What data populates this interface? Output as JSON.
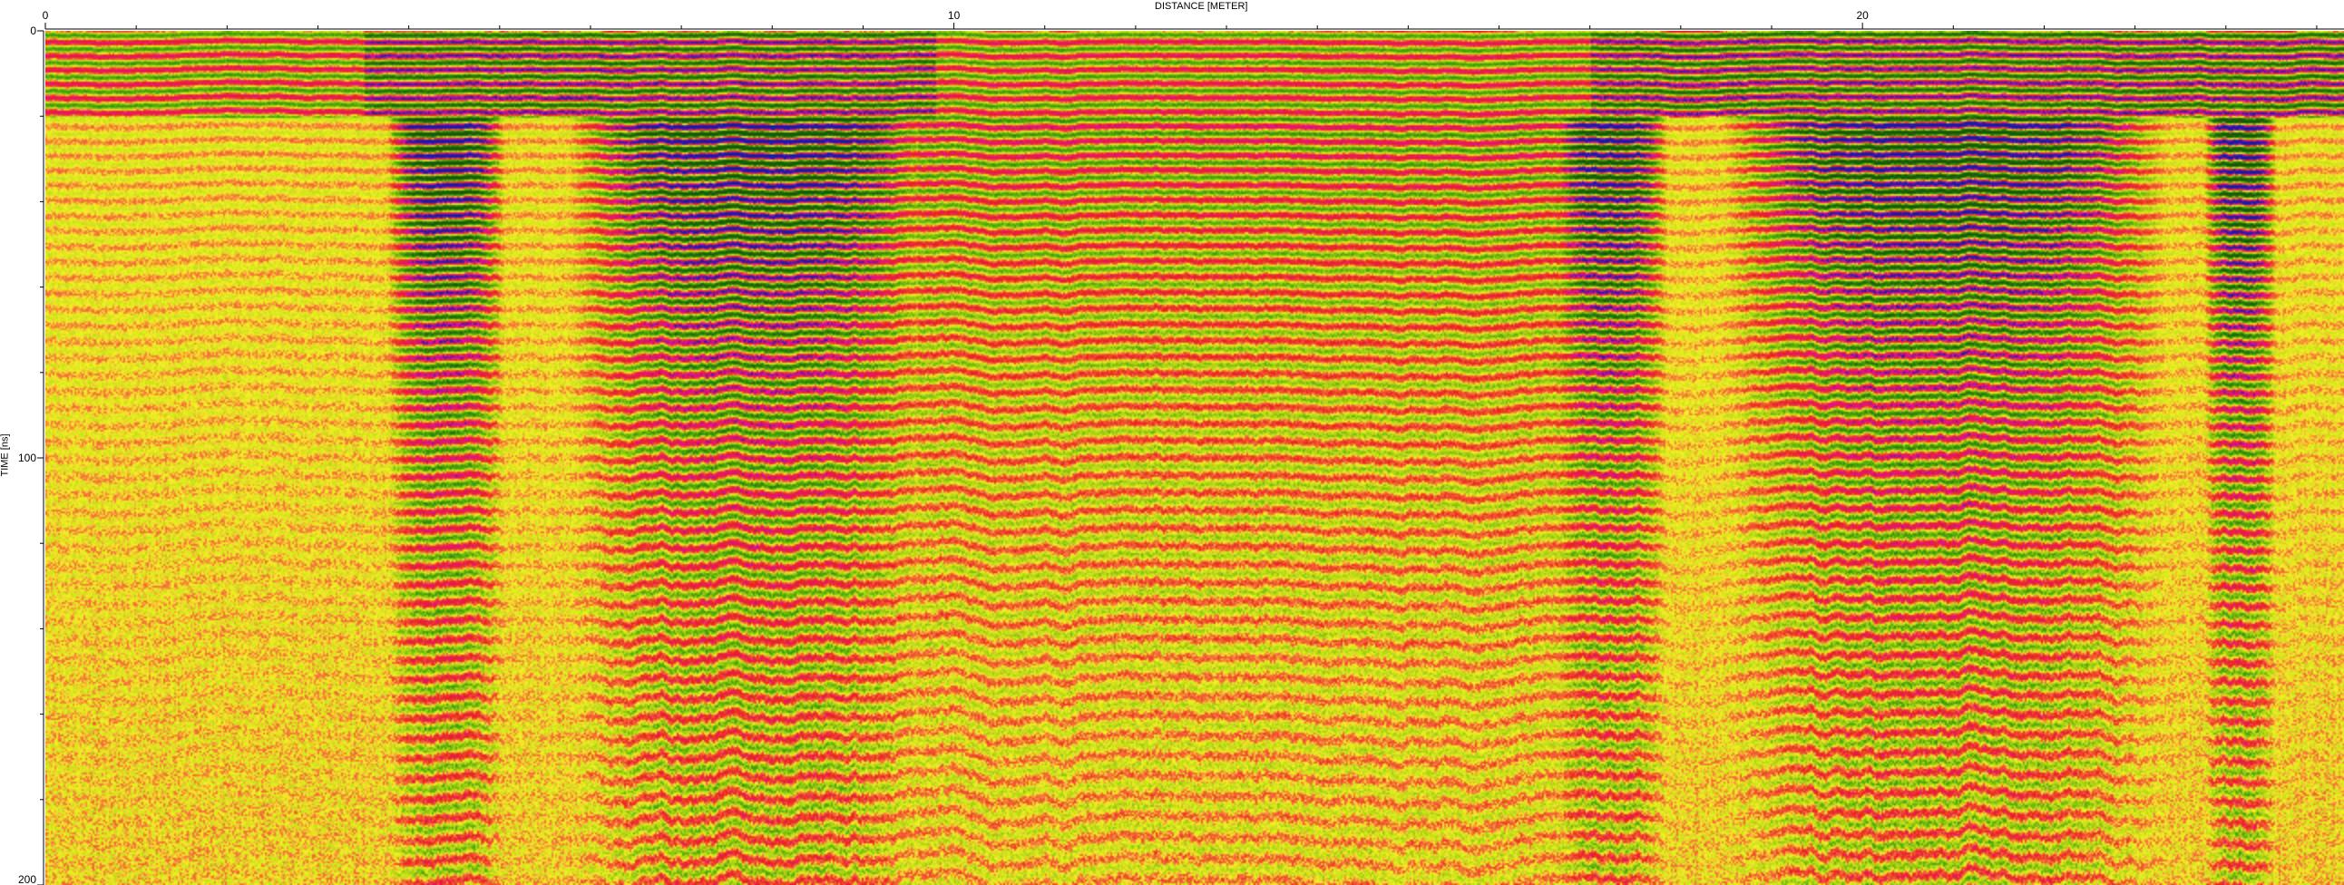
{
  "chart_data": {
    "type": "heatmap",
    "title": "",
    "xlabel": "DISTANCE [METER]",
    "ylabel": "TIME [ns]",
    "xlim": [
      0,
      25.3
    ],
    "ylim": [
      0,
      200
    ],
    "x_ticks": [
      0,
      10,
      20
    ],
    "y_ticks": [
      0,
      100,
      200
    ],
    "colormap": [
      "#1a1aa8",
      "#e6109b",
      "#e8201c",
      "#f5f226",
      "#45a80a"
    ],
    "strong_reflection_zones_m": [
      [
        4.0,
        4.8
      ],
      [
        6.0,
        9.6
      ],
      [
        16.8,
        17.6
      ],
      [
        18.7,
        23.1
      ],
      [
        24.0,
        24.3
      ]
    ],
    "surface_band_ns": [
      0,
      20
    ]
  }
}
